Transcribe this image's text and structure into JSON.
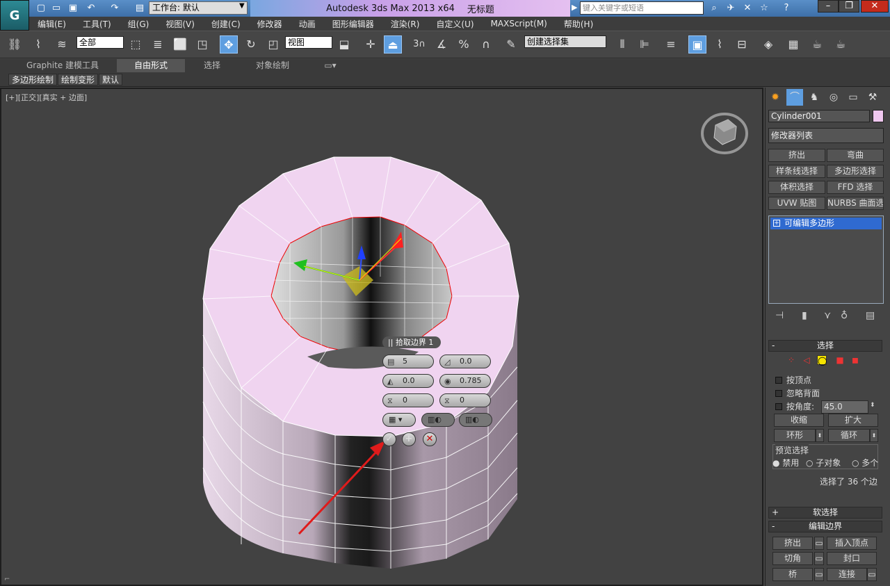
{
  "title": {
    "workspace_label": "工作台: 默认",
    "app_name": "Autodesk 3ds Max  2013 x64",
    "file_name": "无标题",
    "search_placeholder": "键入关键字或短语"
  },
  "menu": [
    "编辑(E)",
    "工具(T)",
    "组(G)",
    "视图(V)",
    "创建(C)",
    "修改器",
    "动画",
    "图形编辑器",
    "渲染(R)",
    "自定义(U)",
    "MAXScript(M)",
    "帮助(H)"
  ],
  "toolbar": {
    "selection_filter": "全部",
    "ref_coord": "视图",
    "named_selection": "创建选择集",
    "snap_label": "3"
  },
  "ribbon": {
    "tabs": [
      "Graphite 建模工具",
      "自由形式",
      "选择",
      "对象绘制"
    ],
    "subtabs": [
      "多边形绘制",
      "绘制变形",
      "默认"
    ]
  },
  "viewport": {
    "label": "[+][正交][真实 + 边面]"
  },
  "caddy": {
    "title": "|| 拾取边界  1",
    "fields": [
      "5",
      "0.0",
      "0.0",
      "0.785",
      "0",
      "0"
    ]
  },
  "panel": {
    "object_name": "Cylinder001",
    "object_color": "#f0c8f0",
    "modifier_list": "修改器列表",
    "mod_buttons": [
      "挤出",
      "弯曲",
      "样条线选择",
      "多边形选择",
      "体积选择",
      "FFD 选择",
      "UVW 贴图",
      "NURBS 曲面选择"
    ],
    "stack_item": "可编辑多边形",
    "rollout_select": "选择",
    "chk_vertex": "按顶点",
    "chk_backface": "忽略背面",
    "chk_angle": "按角度:",
    "angle_value": "45.0",
    "btn_shrink": "收缩",
    "btn_grow": "扩大",
    "btn_ring": "环形",
    "btn_loop": "循环",
    "preview_label": "预览选择",
    "radio_off": "禁用",
    "radio_sub": "子对象",
    "radio_multi": "多个",
    "selected_info": "选择了 36 个边",
    "rollout_soft": "软选择",
    "rollout_edit_border": "编辑边界",
    "edit_buttons": [
      "挤出",
      "插入顶点",
      "切角",
      "封口",
      "桥",
      "连接"
    ]
  },
  "colors": {
    "accent": "#5e9ee0",
    "annotation_arrow": "#e01b1b",
    "cylinder_top": "#f0d4f0"
  }
}
